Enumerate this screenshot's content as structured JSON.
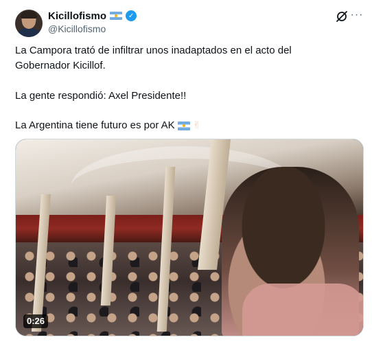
{
  "author": {
    "display_name": "Kicillofismo",
    "handle": "@Kicillofismo",
    "verified": true,
    "badge_color": "#1d9bf0"
  },
  "header_actions": {
    "grok_icon": "grok-icon",
    "more_icon": "more-options-icon",
    "more_label": "···"
  },
  "tweet": {
    "line1": "La Campora trató de infiltrar unos inadaptados en el acto del",
    "line2": "Gobernador Kicillof.",
    "line3": "La gente respondió: Axel Presidente!!",
    "line4": "La Argentina tiene futuro es por AK",
    "line4_emojis": [
      "argentina-flag",
      "victory-hand"
    ]
  },
  "video": {
    "duration": "0:26"
  }
}
